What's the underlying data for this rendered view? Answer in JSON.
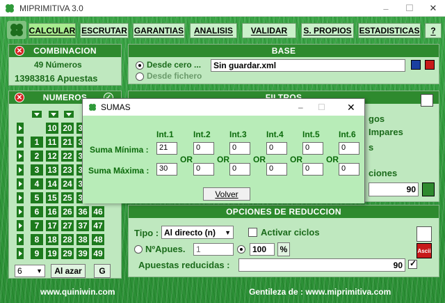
{
  "window": {
    "title": "MIPRIMITIVA 3.0"
  },
  "menu": [
    {
      "label": "CALCULAR"
    },
    {
      "label": "ESCRUTAR"
    },
    {
      "label": "GARANTIAS"
    },
    {
      "label": "ANALISIS"
    },
    {
      "label": "VALIDAR"
    },
    {
      "label": "S. PROPIOS"
    },
    {
      "label": "ESTADISTICAS"
    },
    {
      "label": "?"
    }
  ],
  "combinacion": {
    "title": "COMBINACION",
    "numeros": "49 Números",
    "apuestas": "13983816 Apuestas"
  },
  "base": {
    "title": "BASE",
    "desde_cero": "Desde cero ...",
    "desde_fichero": "Desde fichero",
    "file_value": "Sin guardar.xml"
  },
  "numeros": {
    "title": "NUMEROS",
    "rows": [
      [
        "",
        "10",
        "20",
        "30"
      ],
      [
        "1",
        "11",
        "21",
        "31"
      ],
      [
        "2",
        "12",
        "22",
        "32"
      ],
      [
        "3",
        "13",
        "23",
        "33"
      ],
      [
        "4",
        "14",
        "24",
        "34"
      ],
      [
        "5",
        "15",
        "25",
        "35"
      ],
      [
        "6",
        "16",
        "26",
        "36",
        "46"
      ],
      [
        "7",
        "17",
        "27",
        "37",
        "47"
      ],
      [
        "8",
        "18",
        "28",
        "38",
        "48"
      ],
      [
        "9",
        "19",
        "29",
        "39",
        "49"
      ]
    ],
    "select_value": "6",
    "al_azar": "Al azar",
    "g": "G"
  },
  "filtros": {
    "title": "FILTROS",
    "partial1": "gos",
    "partial2": "Impares",
    "partial3": "s",
    "partial4": "ciones",
    "value": "90"
  },
  "reduccion": {
    "title": "OPCIONES DE REDUCCION",
    "tipo_label": "Tipo :",
    "tipo_value": "Al directo (n)",
    "activar": "Activar ciclos",
    "napues_label": "NºApues.",
    "napues_value": "1",
    "pct_value": "100",
    "pct_symbol": "%",
    "reducidas_label": "Apuestas reducidas :",
    "reducidas_value": "90",
    "ascii": "Ascii"
  },
  "footer": {
    "left": "www.quiniwin.com",
    "right": "Gentileza de :  www.miprimitiva.com"
  },
  "dialog": {
    "title": "SUMAS",
    "headers": [
      "Int.1",
      "Int.2",
      "Int.3",
      "Int.4",
      "Int.5",
      "Int.6"
    ],
    "min_label": "Suma Mínima :",
    "max_label": "Suma Máxima :",
    "min_values": [
      "21",
      "0",
      "0",
      "0",
      "0",
      "0"
    ],
    "max_values": [
      "30",
      "0",
      "0",
      "0",
      "0",
      "0"
    ],
    "or": "OR",
    "volver": "Volver"
  },
  "colors": {
    "accent": "#2e8a2e",
    "panel": "#bfe8bf",
    "dialog_body": "#b8ecb8"
  }
}
